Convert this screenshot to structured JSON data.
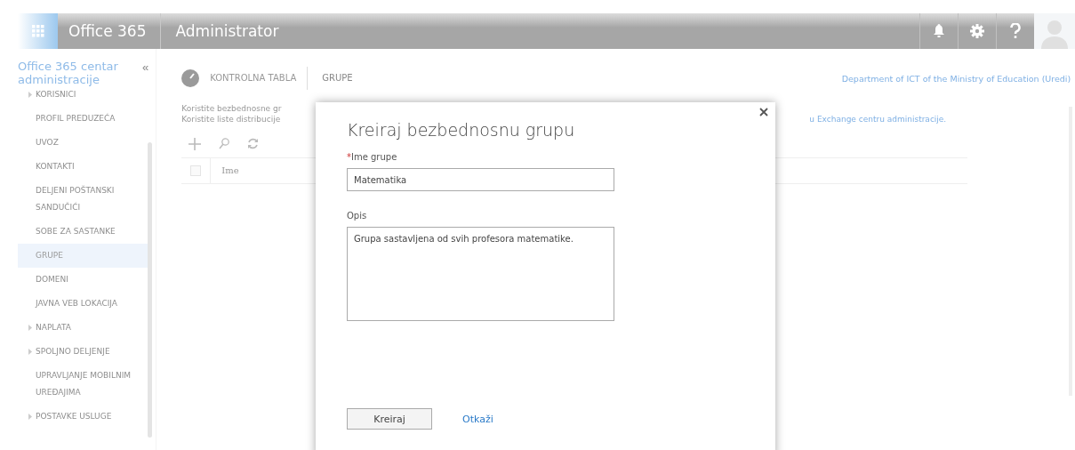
{
  "header": {
    "app_name": "Office 365",
    "title": "Administrator"
  },
  "sidebar": {
    "title": "Office 365 centar administracije",
    "collapse": "«",
    "items": [
      {
        "label": "KORISNICI",
        "expandable": true,
        "selected": false
      },
      {
        "label": "PROFIL PREDUZEĆA",
        "expandable": false,
        "selected": false
      },
      {
        "label": "UVOZ",
        "expandable": false,
        "selected": false
      },
      {
        "label": "KONTAKTI",
        "expandable": false,
        "selected": false
      },
      {
        "label": "DELJENI POŠTANSKI SANDUČIĆI",
        "expandable": false,
        "selected": false
      },
      {
        "label": "SOBE ZA SASTANKE",
        "expandable": false,
        "selected": false
      },
      {
        "label": "GRUPE",
        "expandable": false,
        "selected": true
      },
      {
        "label": "DOMENI",
        "expandable": false,
        "selected": false
      },
      {
        "label": "JAVNA VEB LOKACIJA",
        "expandable": false,
        "selected": false
      },
      {
        "label": "NAPLATA",
        "expandable": true,
        "selected": false
      },
      {
        "label": "SPOLJNO DELJENJE",
        "expandable": true,
        "selected": false
      },
      {
        "label": "UPRAVLJANJE MOBILNIM UREĐAJIMA",
        "expandable": false,
        "selected": false
      },
      {
        "label": "POSTAVKE USLUGE",
        "expandable": true,
        "selected": false
      }
    ]
  },
  "breadcrumb": [
    "KONTROLNA TABLA",
    "GRUPE"
  ],
  "organization": "Department of ICT of the Ministry of Education (Uredi)",
  "description": [
    {
      "left": "Koristite bezbednosne gr"
    },
    {
      "left": "Koristite liste distribucije",
      "right": "u Exchange centru administracije."
    }
  ],
  "table": {
    "select_all_checked": false,
    "columns": [
      "Ime"
    ]
  },
  "dialog": {
    "title": "Kreiraj bezbednosnu grupu",
    "required_mark": "*",
    "fields": [
      {
        "label": "Ime grupe",
        "required": true,
        "kind": "input",
        "value": "Matematika"
      },
      {
        "label": "Opis",
        "required": false,
        "kind": "textarea",
        "value": "Grupa sastavljena od svih profesora matematike."
      }
    ],
    "primary_button": "Kreiraj",
    "cancel_link": "Otkaži"
  }
}
